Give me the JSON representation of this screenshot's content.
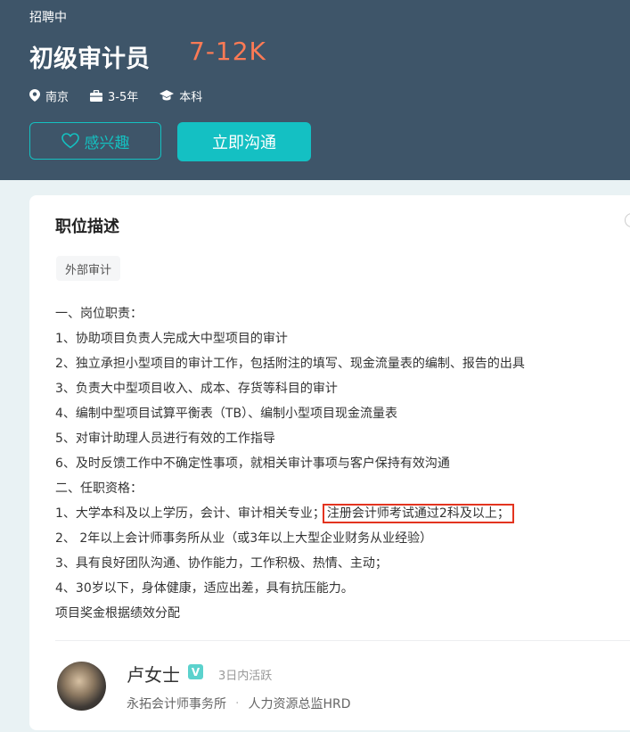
{
  "header": {
    "status": "招聘中",
    "job_title": "初级审计员",
    "salary": "7-12K",
    "location": "南京",
    "experience": "3-5年",
    "education": "本科",
    "interest_button": "感兴趣",
    "chat_button": "立即沟通",
    "icons": [
      "location-pin-icon",
      "briefcase-icon",
      "graduation-cap-icon",
      "heart-icon"
    ]
  },
  "description": {
    "title": "职位描述",
    "tag": "外部审计",
    "lines": [
      "一、岗位职责：",
      "1、协助项目负责人完成大中型项目的审计",
      "2、独立承担小型项目的审计工作，包括附注的填写、现金流量表的编制、报告的出具",
      "3、负责大中型项目收入、成本、存货等科目的审计",
      "4、编制中型项目试算平衡表（TB）、编制小型项目现金流量表",
      "5、对审计助理人员进行有效的工作指导",
      "6、及时反馈工作中不确定性事项，就相关审计事项与客户保持有效沟通",
      "二、任职资格：",
      "1、大学本科及以上学历，会计、审计相关专业；",
      "2、 2年以上会计师事务所从业（或3年以上大型企业财务从业经验）",
      "3、具有良好团队沟通、协作能力，工作积极、热情、主动；",
      "4、30岁以下，身体健康，适应出差，具有抗压能力。",
      "项目奖金根据绩效分配"
    ],
    "highlighted": "注册会计师考试通过2科及以上；"
  },
  "recruiter": {
    "name": "卢女士",
    "verified_badge": "V",
    "active_status": "3日内活跃",
    "company": "永拓会计师事务所",
    "separator": "·",
    "position": "人力资源总监HRD"
  },
  "colors": {
    "header_bg": "#3e5569",
    "salary": "#fc7a55",
    "accent": "#14c1c1",
    "highlight_border": "#e3341f"
  }
}
